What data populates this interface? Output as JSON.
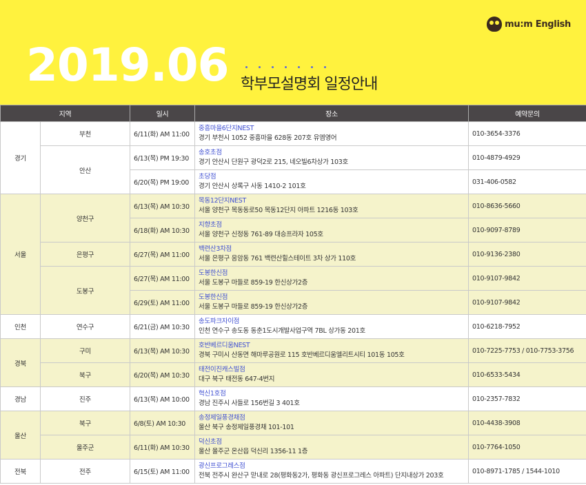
{
  "header": {
    "year_month": "2019.06",
    "subtitle": "학부모설명회 일정안내",
    "brand": "mu:m English",
    "accent": "#fff23e"
  },
  "columns": [
    "지역",
    "일시",
    "장소",
    "예약문의"
  ],
  "rows": [
    {
      "region": "경기",
      "area": "부천",
      "datetime": "6/11(화) AM 11:00",
      "branch": "중흥마을6단지NEST",
      "address": "경기 부천시 1052 중흥마을 628동 207호 유엠영어",
      "phone": "010-3654-3376"
    },
    {
      "area": "안산",
      "datetime": "6/13(목) PM 19:30",
      "branch": "송호초점",
      "address": "경기 안산시 단원구 광덕2로 215, 네오빌6차상가 103호",
      "phone": "010-4879-4929"
    },
    {
      "datetime": "6/20(목) PM 19:00",
      "branch": "초당점",
      "address": "경기 안산시 상록구 사동 1410-2 101호",
      "phone": "031-406-0582"
    },
    {
      "region": "서울",
      "area": "양천구",
      "datetime": "6/13(목) AM 10:30",
      "branch": "목동12단지NEST",
      "address": "서울 양천구 목동동로50 목동12단지 아파트 1216동 103호",
      "phone": "010-8636-5660"
    },
    {
      "datetime": "6/18(화) AM 10:30",
      "branch": "지향초점",
      "address": "서울 양천구 신정동 761-89 대승프라자 105호",
      "phone": "010-9097-8789"
    },
    {
      "area": "은평구",
      "datetime": "6/27(목) AM 11:00",
      "branch": "백련산3차점",
      "address": "서울 은평구 응암동 761 백련산힐스테이트 3차 상가 110호",
      "phone": "010-9136-2380"
    },
    {
      "area": "도봉구",
      "datetime": "6/27(목) AM 11:00",
      "branch": "도봉한신점",
      "address": "서울 도봉구 마들로 859-19 한신상가2층",
      "phone": "010-9107-9842"
    },
    {
      "datetime": "6/29(토) AM 11:00",
      "branch": "도봉한신점",
      "address": "서울 도봉구 마들로 859-19 한신상가2층",
      "phone": "010-9107-9842"
    },
    {
      "region": "인천",
      "area": "연수구",
      "datetime": "6/21(금) AM 10:30",
      "branch": "송도파크자이점",
      "address": "인천 연수구 송도동 동춘1도시개발사업구역 7BL 상가동 201호",
      "phone": "010-6218-7952"
    },
    {
      "region": "경북",
      "area": "구미",
      "datetime": "6/13(목) AM 10:30",
      "branch": "호반베르디움NEST",
      "address": "경북 구미시 산동면 해마루공원로 115 호반베르디움엘리트시티 101동 105호",
      "phone": "010-7225-7753 / 010-7753-3756"
    },
    {
      "area": "북구",
      "datetime": "6/20(목) AM 10:30",
      "branch": "태전이진캐스빌점",
      "address": "대구 북구 태전동 647-4번지",
      "phone": "010-6533-5434"
    },
    {
      "region": "경남",
      "area": "진주",
      "datetime": "6/13(목) AM 10:00",
      "branch": "혁신1호점",
      "address": "경남 진주시 사들로 156번길 3 401호",
      "phone": "010-2357-7832"
    },
    {
      "region": "울산",
      "area": "북구",
      "datetime": "6/8(토) AM 10:30",
      "branch": "송정제일풍경채점",
      "address": "울산 북구 송정제일풍경채 101-101",
      "phone": "010-4438-3908"
    },
    {
      "area": "울주군",
      "datetime": "6/11(화) AM 10:30",
      "branch": "덕신초점",
      "address": "울산 울주군 온산읍 덕신리 1356-11 1층",
      "phone": "010-7764-1050"
    },
    {
      "region": "전북",
      "area": "전주",
      "datetime": "6/15(토) AM 11:00",
      "branch": "광신프로그레스점",
      "address": "전북 전주시 완산구 맏내로 28(평화동2가, 평화동 광신프로그레스 아파트) 단지내상가 203호",
      "phone": "010-8971-1785 / 1544-1010"
    }
  ]
}
